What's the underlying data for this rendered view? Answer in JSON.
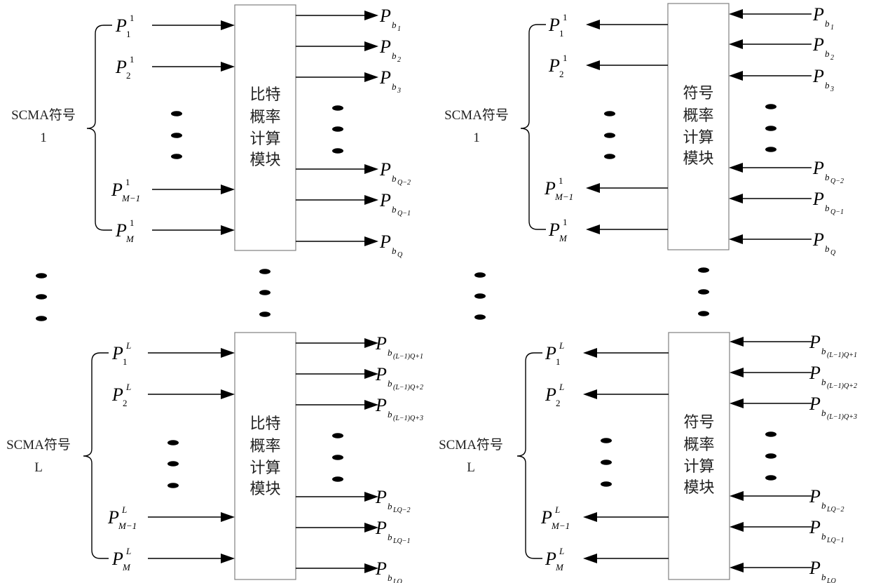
{
  "panels": [
    {
      "id": "bit-group-1",
      "direction": "forward",
      "module_label_lines": [
        "比特",
        "概率",
        "计算",
        "模块"
      ],
      "group_label": [
        "SCMA符号",
        "1"
      ],
      "symbol_probs": [
        {
          "base": "P",
          "sub": "1",
          "sup": "1"
        },
        {
          "base": "P",
          "sub": "2",
          "sup": "1"
        },
        {
          "base": "P",
          "sub": "M−1",
          "sup": "1"
        },
        {
          "base": "P",
          "sub": "M",
          "sup": "1"
        }
      ],
      "bit_probs": [
        {
          "base": "P",
          "sub": "b",
          "subsub": "1"
        },
        {
          "base": "P",
          "sub": "b",
          "subsub": "2"
        },
        {
          "base": "P",
          "sub": "b",
          "subsub": "3"
        },
        {
          "base": "P",
          "sub": "b",
          "subsub": "Q−2"
        },
        {
          "base": "P",
          "sub": "b",
          "subsub": "Q−1"
        },
        {
          "base": "P",
          "sub": "b",
          "subsub": "Q"
        }
      ]
    },
    {
      "id": "symbol-group-1",
      "direction": "reverse",
      "module_label_lines": [
        "符号",
        "概率",
        "计算",
        "模块"
      ],
      "group_label": [
        "SCMA符号",
        "1"
      ],
      "symbol_probs": [
        {
          "base": "P",
          "sub": "1",
          "sup": "1"
        },
        {
          "base": "P",
          "sub": "2",
          "sup": "1"
        },
        {
          "base": "P",
          "sub": "M−1",
          "sup": "1"
        },
        {
          "base": "P",
          "sub": "M",
          "sup": "1"
        }
      ],
      "bit_probs": [
        {
          "base": "P",
          "sub": "b",
          "subsub": "1"
        },
        {
          "base": "P",
          "sub": "b",
          "subsub": "2"
        },
        {
          "base": "P",
          "sub": "b",
          "subsub": "3"
        },
        {
          "base": "P",
          "sub": "b",
          "subsub": "Q−2"
        },
        {
          "base": "P",
          "sub": "b",
          "subsub": "Q−1"
        },
        {
          "base": "P",
          "sub": "b",
          "subsub": "Q"
        }
      ]
    },
    {
      "id": "bit-group-L",
      "direction": "forward",
      "module_label_lines": [
        "比特",
        "概率",
        "计算",
        "模块"
      ],
      "group_label": [
        "SCMA符号",
        "L"
      ],
      "symbol_probs": [
        {
          "base": "P",
          "sub": "1",
          "sup": "L"
        },
        {
          "base": "P",
          "sub": "2",
          "sup": "L"
        },
        {
          "base": "P",
          "sub": "M−1",
          "sup": "L"
        },
        {
          "base": "P",
          "sub": "M",
          "sup": "L"
        }
      ],
      "bit_probs": [
        {
          "base": "P",
          "sub": "b",
          "subsub": "(L−1)Q+1"
        },
        {
          "base": "P",
          "sub": "b",
          "subsub": "(L−1)Q+2"
        },
        {
          "base": "P",
          "sub": "b",
          "subsub": "(L−1)Q+3"
        },
        {
          "base": "P",
          "sub": "b",
          "subsub": "LQ−2"
        },
        {
          "base": "P",
          "sub": "b",
          "subsub": "LQ−1"
        },
        {
          "base": "P",
          "sub": "b",
          "subsub": "LQ"
        }
      ]
    },
    {
      "id": "symbol-group-L",
      "direction": "reverse",
      "module_label_lines": [
        "符号",
        "概率",
        "计算",
        "模块"
      ],
      "group_label": [
        "SCMA符号",
        "L"
      ],
      "symbol_probs": [
        {
          "base": "P",
          "sub": "1",
          "sup": "L"
        },
        {
          "base": "P",
          "sub": "2",
          "sup": "L"
        },
        {
          "base": "P",
          "sub": "M−1",
          "sup": "L"
        },
        {
          "base": "P",
          "sub": "M",
          "sup": "L"
        }
      ],
      "bit_probs": [
        {
          "base": "P",
          "sub": "b",
          "subsub": "(L−1)Q+1"
        },
        {
          "base": "P",
          "sub": "b",
          "subsub": "(L−1)Q+2"
        },
        {
          "base": "P",
          "sub": "b",
          "subsub": "(L−1)Q+3"
        },
        {
          "base": "P",
          "sub": "b",
          "subsub": "LQ−2"
        },
        {
          "base": "P",
          "sub": "b",
          "subsub": "LQ−1"
        },
        {
          "base": "P",
          "sub": "b",
          "subsub": "LQ"
        }
      ]
    }
  ],
  "ellipsis_glyph": "vertical-dots"
}
